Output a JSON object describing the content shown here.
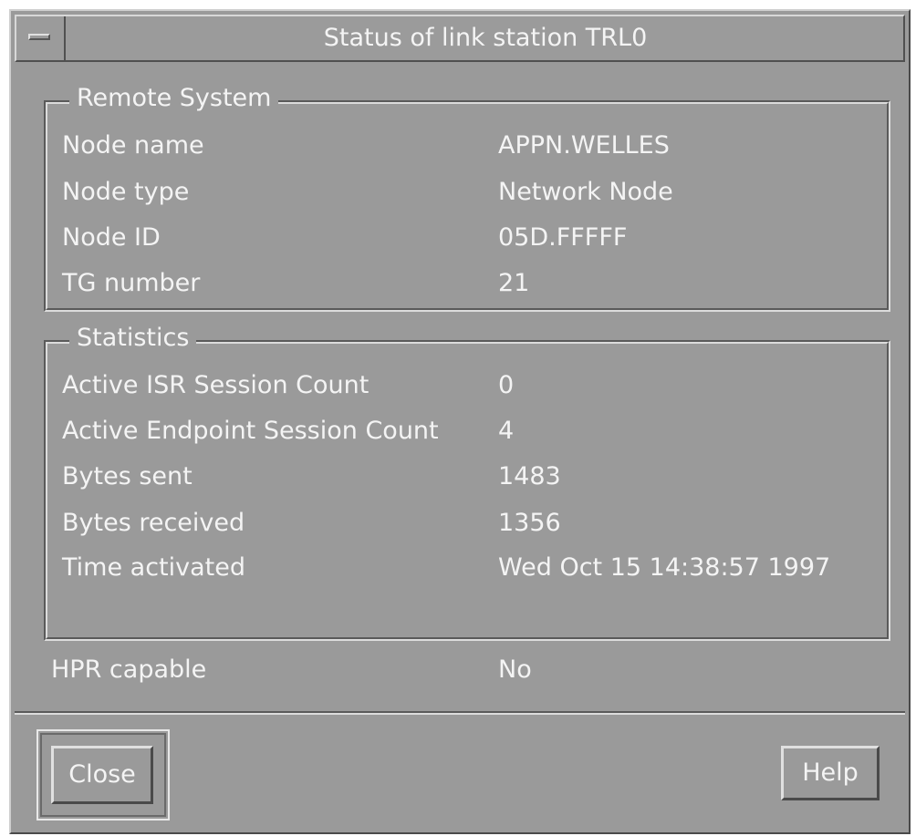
{
  "window": {
    "title": "Status of link station TRL0"
  },
  "remote_system": {
    "legend": "Remote System",
    "rows": [
      {
        "label": "Node name",
        "value": "APPN.WELLES"
      },
      {
        "label": "Node type",
        "value": "Network Node"
      },
      {
        "label": "Node ID",
        "value": "05D.FFFFF"
      },
      {
        "label": "TG number",
        "value": "21"
      }
    ]
  },
  "statistics": {
    "legend": "Statistics",
    "rows": [
      {
        "label": "Active ISR Session Count",
        "value": "0"
      },
      {
        "label": "Active Endpoint Session Count",
        "value": "4"
      },
      {
        "label": "Bytes sent",
        "value": "1483"
      },
      {
        "label": "Bytes received",
        "value": "1356"
      },
      {
        "label": "Time activated",
        "value": "Wed Oct 15 14:38:57 1997"
      }
    ]
  },
  "hpr": {
    "label": "HPR capable",
    "value": "No"
  },
  "buttons": {
    "close": "Close",
    "help": "Help"
  }
}
